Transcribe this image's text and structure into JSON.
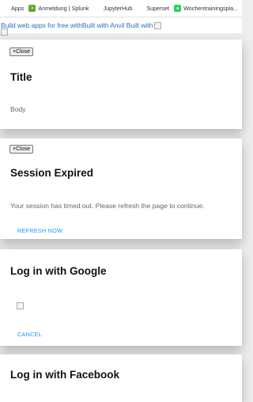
{
  "bookmarks": [
    {
      "icon": "apps-grid-icon",
      "label": "Apps"
    },
    {
      "icon": "splunk-icon",
      "label": "Anmeldung | Splunk"
    },
    {
      "icon": "jupyter-icon",
      "label": "JupyterHub"
    },
    {
      "icon": "superset-icon",
      "label": "Superset"
    },
    {
      "icon": "whatsapp-icon",
      "label": "Wochentrainingspla..."
    },
    {
      "icon": "gitlab-icon",
      "label": ""
    }
  ],
  "banner": {
    "text": "Build web apps for free withBuilt with Anvil Built with"
  },
  "modals": {
    "generic": {
      "close_label": "×Close",
      "title": "Title",
      "body": "Body"
    },
    "session": {
      "close_label": "×Close",
      "title": "Session Expired",
      "body": "Your session has timed out. Please refresh the page to continue.",
      "action": "REFRESH NOW"
    },
    "google": {
      "title": "Log in with Google",
      "action": "CANCEL"
    },
    "facebook": {
      "title": "Log in with Facebook"
    }
  },
  "colors": {
    "link": "#2a6cc2",
    "action": "#2196f3",
    "background": "#eeeeee"
  }
}
